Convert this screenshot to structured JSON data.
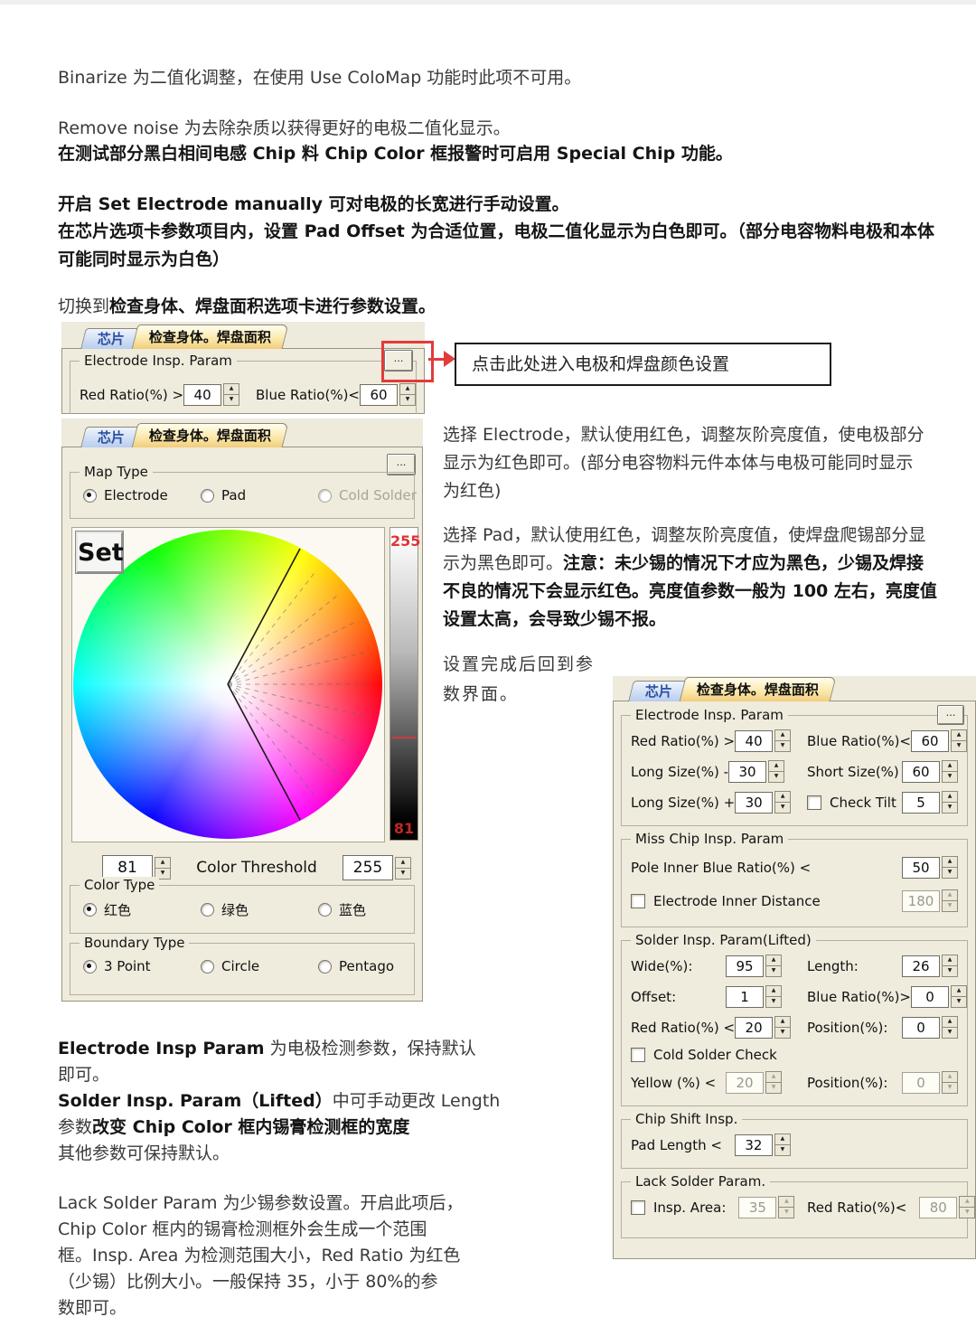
{
  "tabs": {
    "chip": "芯片",
    "body": "检查身体。焊盘面积"
  },
  "colors": {
    "accent_red": "#e23b3b",
    "panel_bg": "#eeeadc",
    "tab_active": "#f1cd7c",
    "tab_inactive_text": "#2d4fa0",
    "bar_label_red": "#e03434"
  },
  "texts": {
    "blocks": {
      "p1": {
        "lines": [
          [
            {
              "t": "Binarize 为二值化调整，在使用 Use ColoMap 功能时此项不可用。"
            }
          ]
        ]
      },
      "p2": {
        "lines": [
          [
            {
              "t": "Remove noise 为去除杂质以获得更好的电极二值化显示。"
            }
          ]
        ]
      },
      "p3": {
        "lines": [
          [
            {
              "t": "在测试部分黑白相间电感 Chip 料 Chip Color 框报警时可启用 Special Chip 功能。",
              "b": 1
            }
          ]
        ]
      },
      "p4": {
        "lines": [
          [
            {
              "t": "开启 Set Electrode manually 可对电极的长宽进行手动设置。",
              "b": 1
            }
          ]
        ]
      },
      "p5": {
        "lines": [
          [
            {
              "t": "在芯片选项卡参数项目内，设置 Pad Offset 为合适位置，电极二值化显示为白色即可。（部分电容物料电极和本体",
              "b": 1
            }
          ],
          [
            {
              "t": "可能同时显示为白色）",
              "b": 1
            }
          ]
        ]
      },
      "p6": {
        "lines": [
          [
            {
              "t": "切换到"
            },
            {
              "t": "检查身体、焊盘面积选项卡进行参数设置。",
              "b": 1
            }
          ]
        ]
      },
      "r1": {
        "lines": [
          [
            {
              "t": "选择 Electrode，默认使用红色，调整灰阶亮度值，使电极部分"
            }
          ],
          [
            {
              "t": "显示为红色即可。(部分电容物料元件本体与电极可能同时显示"
            }
          ],
          [
            {
              "t": "为红色)"
            }
          ]
        ]
      },
      "r2": {
        "lines": [
          [
            {
              "t": "选择 Pad，默认使用红色，调整灰阶亮度值，使焊盘爬锡部分显"
            }
          ],
          [
            {
              "t": "示为黑色即可。"
            },
            {
              "t": "注意：未少锡的情况下才应为黑色，少锡及焊接",
              "b": 1
            }
          ],
          [
            {
              "t": "不良的情况下会显示红色。亮度值参数一般为 100 左右，亮度值",
              "b": 1
            }
          ],
          [
            {
              "t": "设置太高，会导致少锡不报。",
              "b": 1
            }
          ]
        ]
      },
      "r3": {
        "lines": [
          [
            {
              "t": "设置完成后回到参"
            }
          ],
          [
            {
              "t": "数界面。"
            }
          ]
        ]
      },
      "b1": {
        "lines": [
          [
            {
              "t": "Electrode Insp Param",
              "b": 1
            },
            {
              "t": " 为电极检测参数，保持默认"
            }
          ],
          [
            {
              "t": "即可。"
            }
          ],
          [
            {
              "t": "Solder Insp. Param（Lifted）",
              "b": 1
            },
            {
              "t": "中可手动更改 Length"
            }
          ],
          [
            {
              "t": "参数"
            },
            {
              "t": "改变 Chip Color 框内锡膏检测框的宽度",
              "b": 1
            }
          ],
          [
            {
              "t": "其他参数可保持默认。"
            }
          ]
        ]
      },
      "b2": {
        "lines": [
          [
            {
              "t": "Lack Solder Param 为少锡参数设置。开启此项后，"
            }
          ],
          [
            {
              "t": "Chip Color 框内的锡膏检测框外会生成一个范围"
            }
          ],
          [
            {
              "t": "框。Insp. Area 为检测范围大小，Red Ratio 为红色"
            }
          ],
          [
            {
              "t": "（少锡）比例大小。一般保持 35，小于 80%的参"
            }
          ],
          [
            {
              "t": "数即可。"
            }
          ]
        ]
      }
    }
  },
  "callout": {
    "text": "点击此处进入电极和焊盘颜色设置"
  },
  "panel_small": {
    "group_title": "Electrode Insp. Param",
    "more_label": "...",
    "fields": [
      {
        "label": "Red Ratio(%) >",
        "value": "40"
      },
      {
        "label": "Blue Ratio(%)<",
        "value": "60"
      }
    ]
  },
  "panel_color": {
    "more_label": "...",
    "map_type": {
      "title": "Map Type",
      "options": [
        {
          "label": "Electrode",
          "selected": true
        },
        {
          "label": "Pad"
        },
        {
          "label": "Cold Solder",
          "disabled": true
        }
      ]
    },
    "set_button": "Set",
    "bar": {
      "top": "255",
      "bottom": "81"
    },
    "threshold": {
      "left": "81",
      "label": "Color Threshold",
      "right": "255"
    },
    "color_type": {
      "title": "Color Type",
      "options": [
        {
          "label": "红色",
          "selected": true
        },
        {
          "label": "绿色"
        },
        {
          "label": "蓝色"
        }
      ]
    },
    "boundary_type": {
      "title": "Boundary Type",
      "options": [
        {
          "label": "3 Point",
          "selected": true
        },
        {
          "label": "Circle"
        },
        {
          "label": "Pentago"
        }
      ]
    }
  },
  "panel_params": {
    "more_label": "...",
    "groups": [
      {
        "title": "Electrode Insp. Param",
        "more": true,
        "rows": [
          [
            {
              "label": "Red Ratio(%) >",
              "value": "40"
            },
            {
              "label": "Blue Ratio(%)<",
              "value": "60"
            }
          ],
          [
            {
              "label": "Long Size(%) -",
              "value": "30"
            },
            {
              "label": "Short Size(%)",
              "value": "60"
            }
          ],
          [
            {
              "label": "Long Size(%) +",
              "value": "30"
            },
            {
              "label": "Check Tilt",
              "value": "5",
              "check": true
            }
          ]
        ]
      },
      {
        "title": "Miss Chip Insp. Param",
        "rows": [
          [
            {
              "label": "Pole Inner Blue Ratio(%) <",
              "value": "50",
              "full": true
            }
          ],
          [
            {
              "label": "Electrode Inner Distance",
              "value": "180",
              "check": true,
              "disabled": true,
              "full": true
            }
          ]
        ]
      },
      {
        "title": "Solder Insp. Param(Lifted)",
        "rows": [
          [
            {
              "label": "Wide(%):",
              "value": "95"
            },
            {
              "label": "Length:",
              "value": "26"
            }
          ],
          [
            {
              "label": "Offset:",
              "value": "1"
            },
            {
              "label": "Blue Ratio(%)>",
              "value": "0"
            }
          ],
          [
            {
              "label": "Red Ratio(%) <",
              "value": "20"
            },
            {
              "label": "Position(%):",
              "value": "0"
            }
          ],
          [
            {
              "label": "Cold Solder Check",
              "check": true,
              "novalue": true,
              "full": true
            }
          ],
          [
            {
              "label": "Yellow (%) <",
              "value": "20",
              "disabled": true
            },
            {
              "label": "Position(%):",
              "value": "0",
              "disabled": true
            }
          ]
        ]
      },
      {
        "title": "Chip Shift Insp.",
        "rows": [
          [
            {
              "label": "Pad Length <",
              "value": "32",
              "inline": true,
              "full": true
            }
          ]
        ]
      },
      {
        "title": "Lack Solder Param.",
        "rows": [
          [
            {
              "label": "Insp. Area:",
              "value": "35",
              "check": true,
              "disabled": true,
              "inline": true
            },
            {
              "label": "Red Ratio(%)<",
              "value": "80",
              "disabled": true,
              "inline": true
            }
          ]
        ]
      }
    ]
  }
}
